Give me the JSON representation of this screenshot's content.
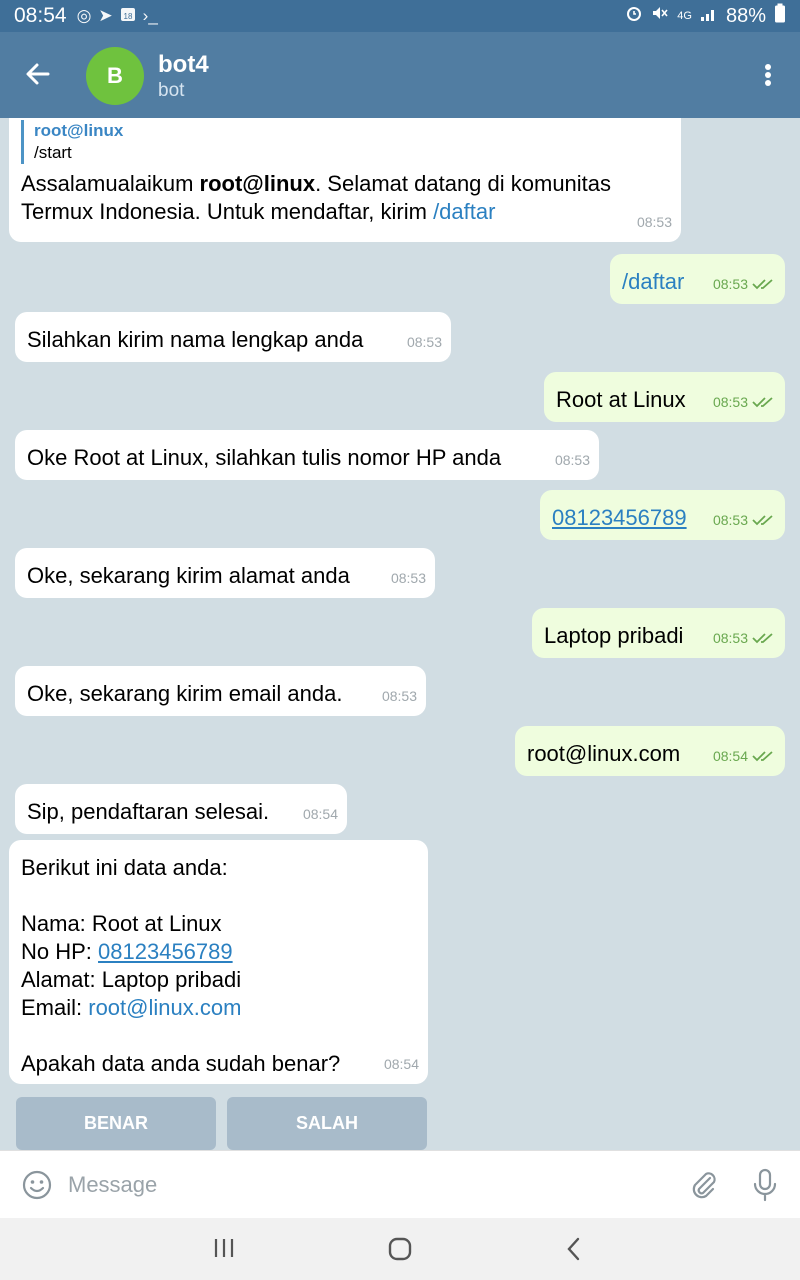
{
  "status": {
    "time": "08:54",
    "battery": "88%",
    "network": "4G",
    "calendar_day": "18"
  },
  "header": {
    "title": "bot4",
    "subtitle": "bot",
    "avatar_letter": "B"
  },
  "messages": [
    {
      "reply_name": "root@linux",
      "reply_text": "/start",
      "text_pre": "Assalamualaikum ",
      "text_bold": "root@linux",
      "text_mid": ". Selamat datang di komunitas Termux Indonesia. Untuk mendaftar, kirim ",
      "text_link": "/daftar",
      "time": "08:53"
    },
    {
      "text": "/daftar",
      "time": "08:53"
    },
    {
      "text": "Silahkan kirim nama lengkap anda",
      "time": "08:53"
    },
    {
      "text": "Root at Linux",
      "time": "08:53"
    },
    {
      "text": "Oke Root at Linux, silahkan tulis nomor HP anda",
      "time": "08:53"
    },
    {
      "text": "08123456789",
      "time": "08:53"
    },
    {
      "text": "Oke, sekarang kirim alamat anda",
      "time": "08:53"
    },
    {
      "text": "Laptop pribadi",
      "time": "08:53"
    },
    {
      "text": "Oke, sekarang kirim email anda.",
      "time": "08:53"
    },
    {
      "text": "root@linux.com",
      "time": "08:54"
    },
    {
      "text": "Sip, pendaftaran selesai.",
      "time": "08:54"
    },
    {
      "intro": "Berikut ini data anda:",
      "nama": "Nama: Root at Linux",
      "hp_label": "No HP: ",
      "hp_value": "08123456789",
      "alamat": "Alamat: Laptop pribadi",
      "email_label": "Email: ",
      "email_value": "root@linux.com",
      "question": "Apakah data anda sudah benar?",
      "time": "08:54"
    }
  ],
  "keyboard": {
    "yes": "BENAR",
    "no": "SALAH"
  },
  "input": {
    "placeholder": "Message"
  },
  "colors": {
    "header": "#517da2",
    "statusbar": "#3f6f98",
    "outgoing": "#effdde",
    "incoming": "#ffffff",
    "link": "#2b80c1",
    "avatar": "#6fc23e"
  }
}
